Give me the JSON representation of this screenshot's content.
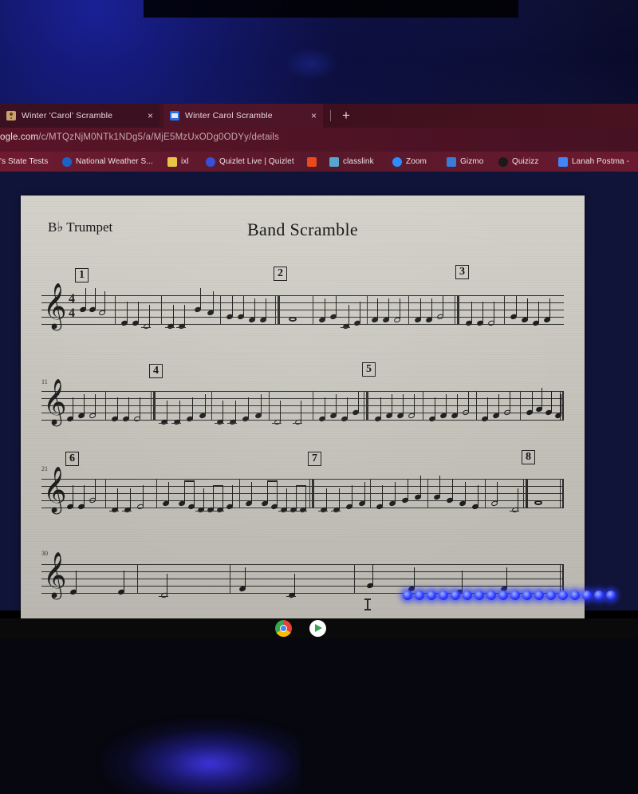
{
  "browser": {
    "tabs": [
      {
        "title": "Winter 'Carol' Scramble",
        "favicon": "person-icon",
        "close": "×"
      },
      {
        "title": "Winter Carol Scramble",
        "favicon": "slides-icon",
        "close": "×"
      }
    ],
    "new_tab_label": "+",
    "url_prefix": "ogle.com",
    "url_path": "/c/MTQzNjM0NTk1NDg5/a/MjE5MzUxODg0ODYy/details",
    "bookmarks": [
      {
        "label": "'s State Tests",
        "color": "#2b2b2b",
        "has_icon": false
      },
      {
        "label": "National Weather S...",
        "color": "#1a64c8",
        "has_icon": true
      },
      {
        "label": "ixl",
        "color": "#e8c547",
        "has_icon": true
      },
      {
        "label": "Quizlet Live | Quizlet",
        "color": "#3a4fd8",
        "has_icon": true
      },
      {
        "label": "",
        "color": "#e8491d",
        "has_icon": true
      },
      {
        "label": "classlink",
        "color": "#57a6cf",
        "has_icon": true
      },
      {
        "label": "Zoom",
        "color": "#2d8cff",
        "has_icon": true
      },
      {
        "label": "Gizmo",
        "color": "#3a7bd5",
        "has_icon": true
      },
      {
        "label": "Quizizz",
        "color": "#1a1a1a",
        "has_icon": true
      },
      {
        "label": "Lanah Postma -",
        "color": "#4285f4",
        "has_icon": true
      }
    ]
  },
  "document": {
    "part_name": "B♭ Trumpet",
    "title": "Band Scramble",
    "systems": [
      {
        "measure_number": "",
        "rehearsal_marks": [
          "1",
          "2",
          "3"
        ],
        "clef": "treble",
        "time_signature": {
          "top": "4",
          "bottom": "4"
        }
      },
      {
        "measure_number": "11",
        "rehearsal_marks": [
          "4",
          "5"
        ],
        "clef": "treble"
      },
      {
        "measure_number": "21",
        "rehearsal_marks": [
          "6",
          "7",
          "8"
        ],
        "clef": "treble"
      },
      {
        "measure_number": "30",
        "rehearsal_marks": [],
        "clef": "treble"
      }
    ]
  },
  "shelf": {
    "apps": [
      {
        "name": "chrome-app-icon"
      },
      {
        "name": "play-store-app-icon"
      }
    ]
  },
  "colors": {
    "browser_chrome": "#4a1326",
    "bookmarks_bar": "#5d1a2e",
    "paper": "#cfcdc4",
    "led_blue": "#2f3cff",
    "desk_backdrop": "#101438"
  }
}
